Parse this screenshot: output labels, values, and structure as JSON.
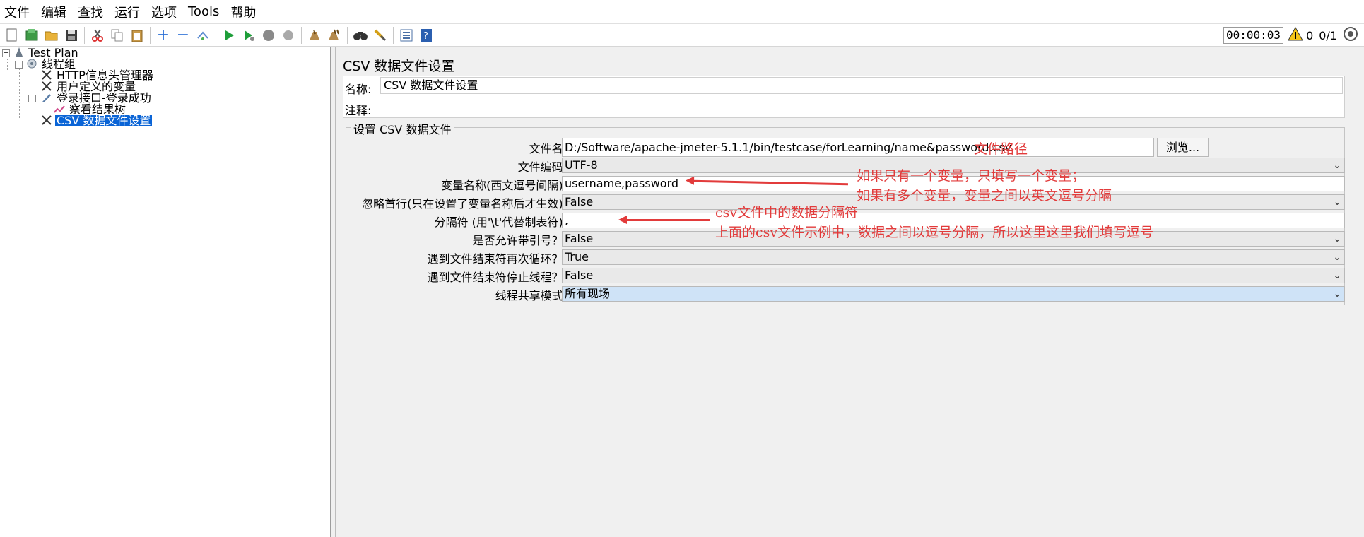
{
  "menu": [
    "文件",
    "编辑",
    "查找",
    "运行",
    "选项",
    "Tools",
    "帮助"
  ],
  "toolbar": {
    "timer": "00:00:03",
    "warning_count": "0",
    "thread_count": "0/1"
  },
  "tree": {
    "nodes": [
      {
        "label": "Test Plan"
      },
      {
        "label": "线程组"
      },
      {
        "label": "HTTP信息头管理器"
      },
      {
        "label": "用户定义的变量"
      },
      {
        "label": "登录接口-登录成功"
      },
      {
        "label": "察看结果树"
      },
      {
        "label": "CSV 数据文件设置"
      }
    ]
  },
  "panel": {
    "title": "CSV 数据文件设置",
    "name_label": "名称:",
    "name_value": "CSV 数据文件设置",
    "comment_label": "注释:",
    "comment_value": "",
    "group_title": "设置 CSV 数据文件",
    "browse_label": "浏览...",
    "fields": [
      {
        "label": "文件名:",
        "value": "D:/Software/apache-jmeter-5.1.1/bin/testcase/forLearning/name&password.csv"
      },
      {
        "label": "文件编码:",
        "value": "UTF-8"
      },
      {
        "label": "变量名称(西文逗号间隔):",
        "value": "username,password"
      },
      {
        "label": "忽略首行(只在设置了变量名称后才生效):",
        "value": "False"
      },
      {
        "label": "分隔符 (用'\\t'代替制表符):",
        "value": ","
      },
      {
        "label": "是否允许带引号？:",
        "value": "False"
      },
      {
        "label": "遇到文件结束符再次循环？:",
        "value": "True"
      },
      {
        "label": "遇到文件结束符停止线程？:",
        "value": "False"
      },
      {
        "label": "线程共享模式:",
        "value": "所有现场"
      }
    ]
  },
  "annotations": {
    "file_path": "文件路径",
    "var_line1": "如果只有一个变量，只填写一个变量；",
    "var_line2": "如果有多个变量，变量之间以英文逗号分隔",
    "sep_line1": "csv文件中的数据分隔符",
    "sep_line2": "上面的csv文件示例中，数据之间以逗号分隔，所以这里这里我们填写逗号"
  },
  "colors": {
    "selection": "#0a64d6",
    "annotation": "#e23b3b",
    "highlight_combo": "#cfe3f7"
  }
}
